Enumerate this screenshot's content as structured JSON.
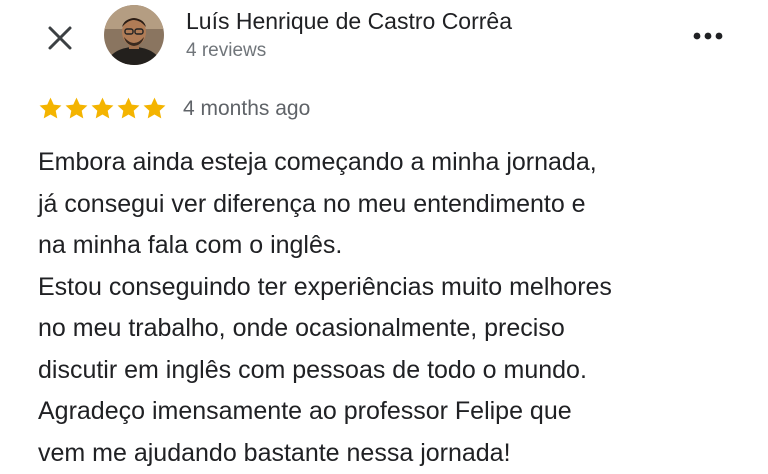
{
  "header": {
    "close_icon": "close-icon",
    "more_icon": "more-horizontal-icon",
    "avatar_icon": "avatar",
    "reviewer_name": "Luís Henrique de Castro Corrêa",
    "review_count": "4 reviews"
  },
  "rating": {
    "stars": 5,
    "max_stars": 5,
    "star_color": "#f4b400",
    "date": "4 months ago"
  },
  "review": {
    "lines": [
      "Embora ainda esteja começando a minha jornada,",
      "já consegui ver diferença no meu entendimento e",
      "na minha fala com o inglês.",
      "Estou conseguindo ter experiências muito melhores",
      "no meu trabalho, onde ocasionalmente, preciso",
      "discutir em inglês com pessoas de todo o mundo.",
      "Agradeço imensamente ao professor Felipe que",
      "vem me ajudando bastante nessa jornada!"
    ]
  }
}
